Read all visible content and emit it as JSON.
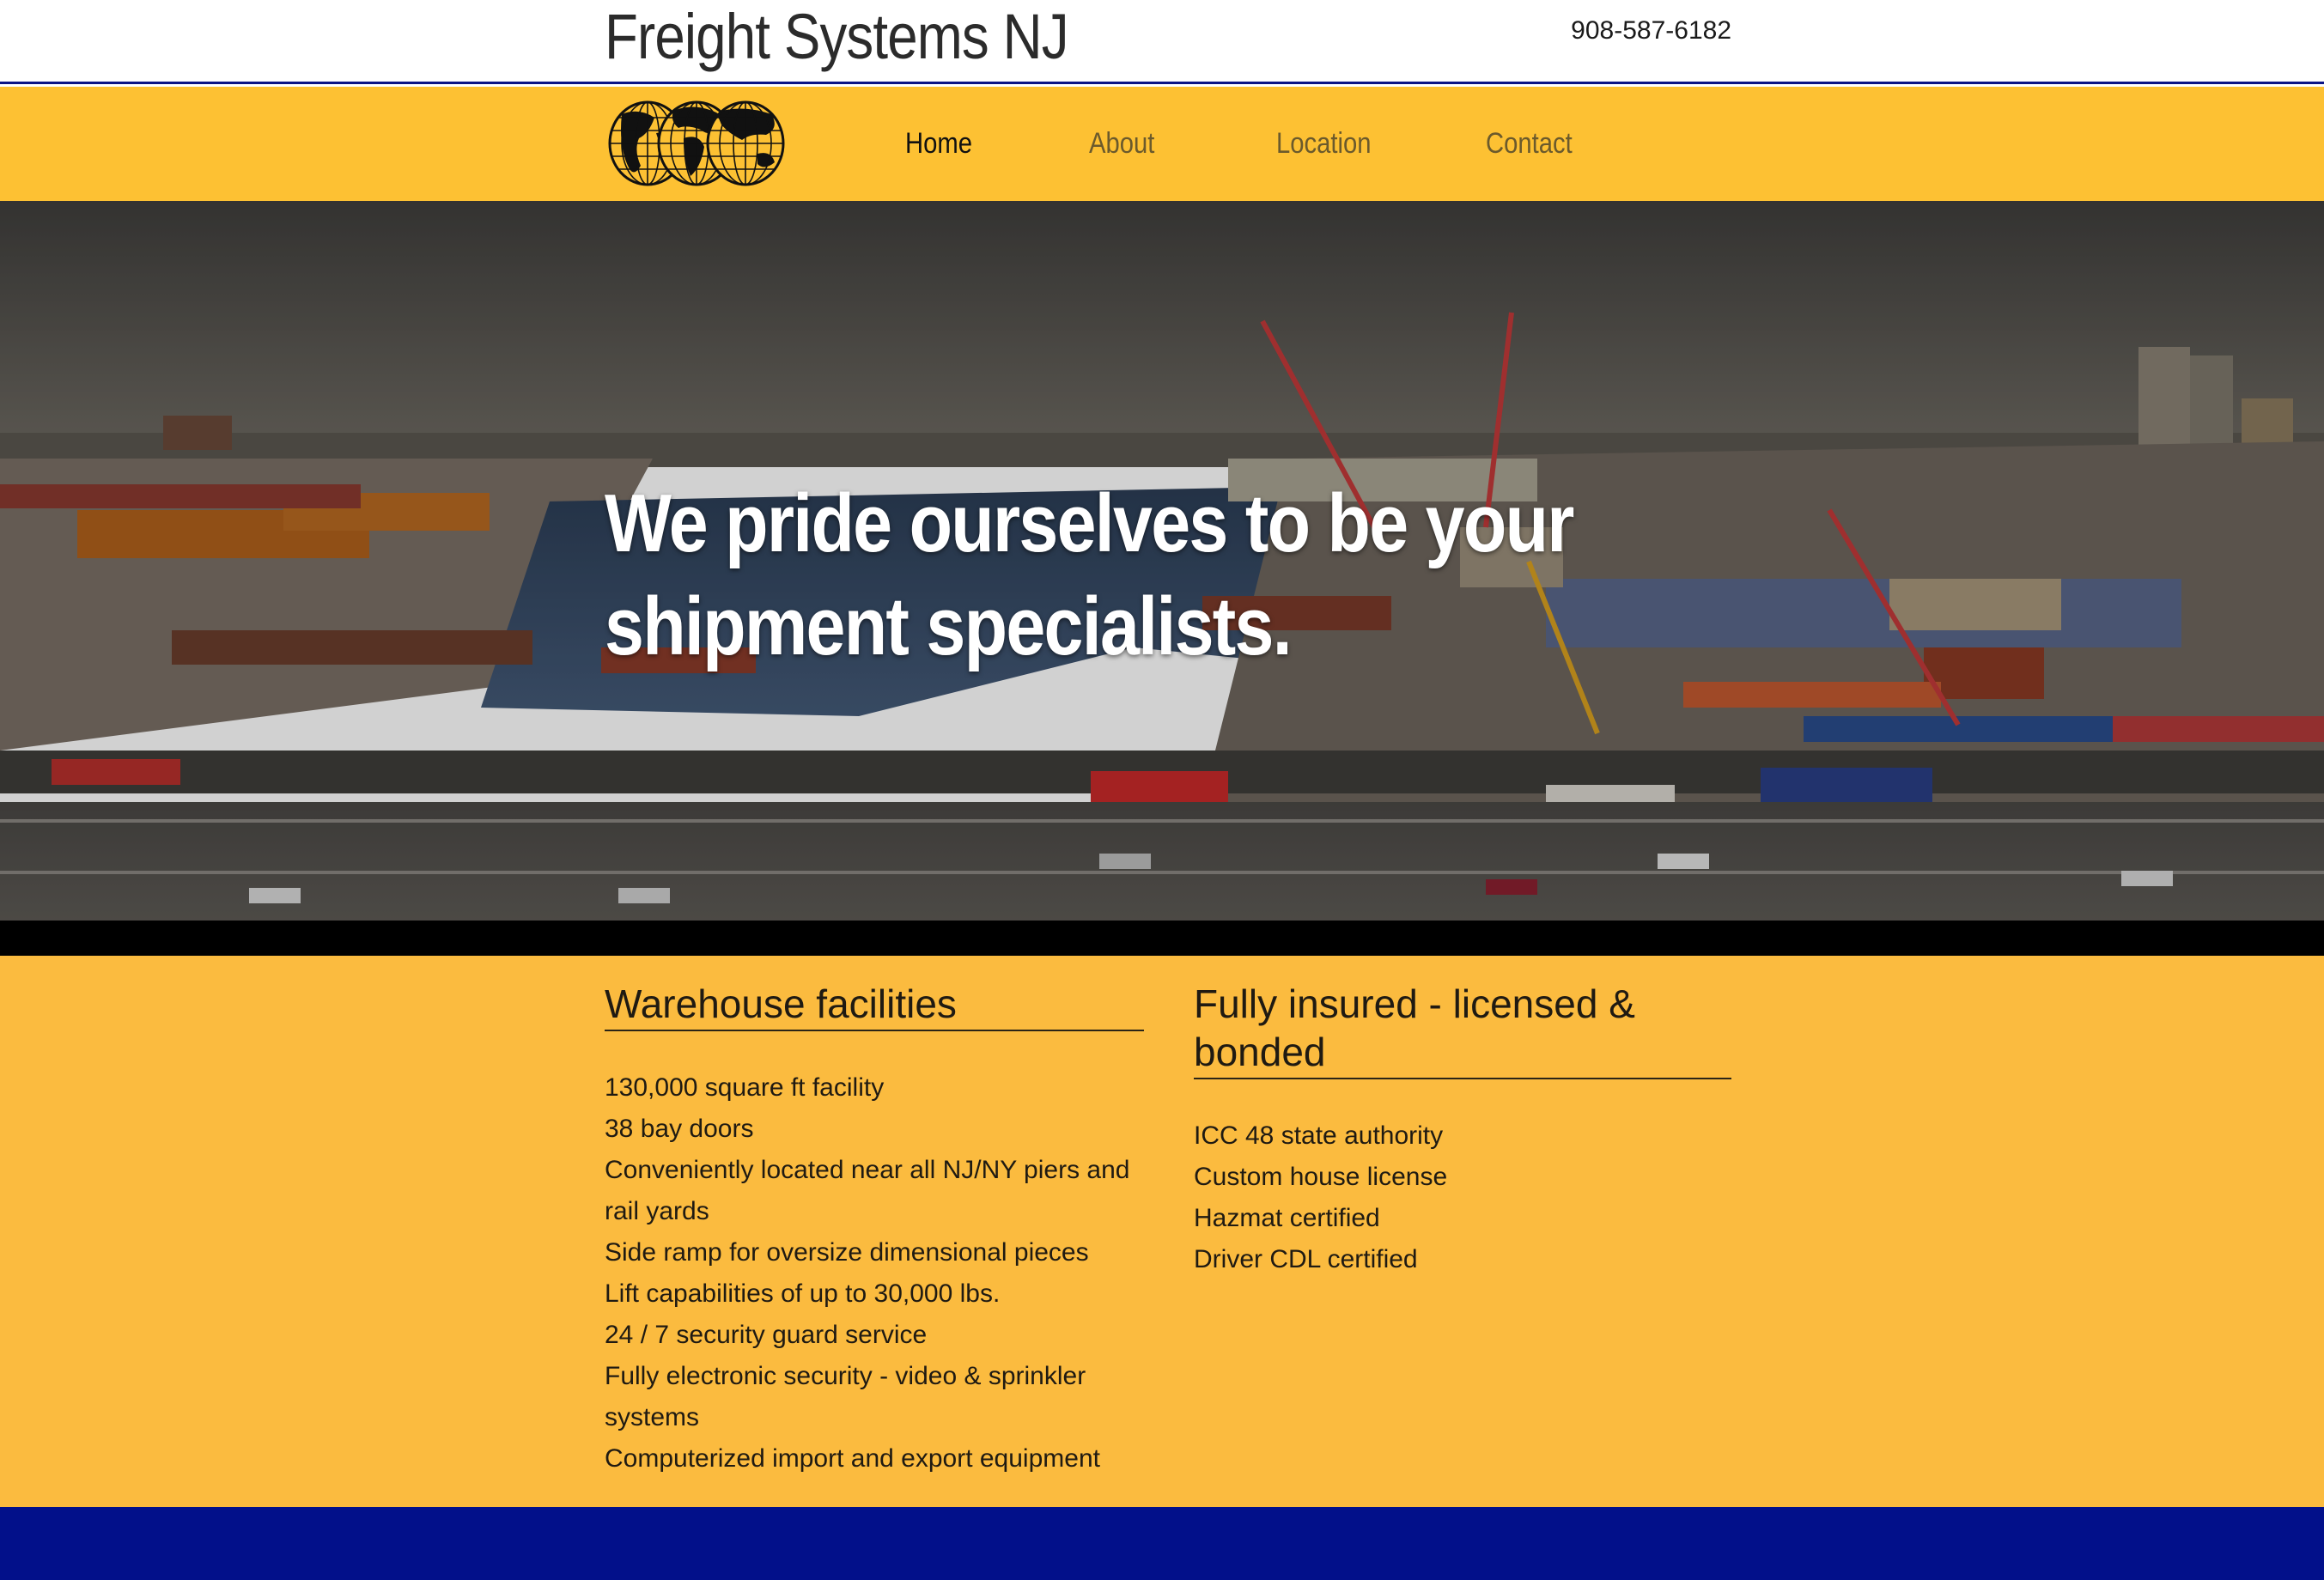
{
  "header": {
    "site_title": "Freight Systems NJ",
    "phone": "908-587-6182"
  },
  "nav": {
    "logo_icon": "three-globes-logo",
    "items": [
      {
        "label": "Home",
        "active": true
      },
      {
        "label": "About",
        "active": false
      },
      {
        "label": "Location",
        "active": false
      },
      {
        "label": "Contact",
        "active": false
      }
    ]
  },
  "hero": {
    "heading": "We pride ourselves to be your shipment specialists."
  },
  "features": {
    "warehouse": {
      "title": "Warehouse facilities",
      "items": [
        "130,000 square ft facility",
        "38 bay doors",
        "Conveniently located near all NJ/NY piers and rail yards",
        "Side ramp for oversize dimensional pieces",
        "Lift capabilities of up to 30,000 lbs.",
        "24 / 7 security guard service",
        "Fully electronic security - video & sprinkler systems",
        "Computerized import and export equipment"
      ]
    },
    "insured": {
      "title": "Fully insured - licensed & bonded",
      "items": [
        "ICC 48 state authority",
        "Custom house license",
        "Hazmat certified",
        "Driver CDL certified"
      ]
    }
  },
  "colors": {
    "header_border": "#0b1486",
    "nav_background": "#fdc133",
    "features_background": "#fbbb3f",
    "footer_background": "#02108a"
  }
}
